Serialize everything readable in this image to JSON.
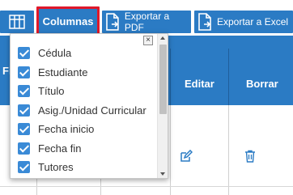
{
  "toolbar": {
    "columns_label": "Columnas",
    "export_pdf_label": "Exportar a PDF",
    "export_excel_label": "Exportar a Excel"
  },
  "table": {
    "headers": {
      "first_partial": "Fi",
      "edit": "Editar",
      "delete": "Borrar"
    }
  },
  "dropdown": {
    "close_label": "×",
    "items": [
      {
        "label": "Cédula",
        "checked": true
      },
      {
        "label": "Estudiante",
        "checked": true
      },
      {
        "label": "Título",
        "checked": true
      },
      {
        "label": "Asig./Unidad Curricular",
        "checked": true
      },
      {
        "label": "Fecha inicio",
        "checked": true
      },
      {
        "label": "Fecha fin",
        "checked": true
      },
      {
        "label": "Tutores",
        "checked": true
      }
    ]
  },
  "colors": {
    "primary": "#2b7bc4",
    "highlight": "#e0182a",
    "checkbox": "#3a8ad6"
  },
  "icons": {
    "columns": "grid-icon",
    "pdf": "document-icon",
    "excel": "document-icon",
    "edit": "edit-icon",
    "delete": "trash-icon"
  }
}
